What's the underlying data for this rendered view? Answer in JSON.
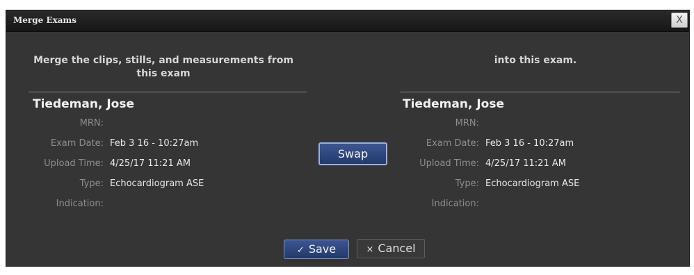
{
  "dialog": {
    "title": "Merge Exams",
    "close_glyph": "X"
  },
  "left": {
    "heading": "Merge the clips, stills, and measurements from this exam",
    "patient": "Tiedeman, Jose",
    "fields": [
      {
        "label": "MRN:",
        "value": ""
      },
      {
        "label": "Exam Date:",
        "value": "Feb 3 16 - 10:27am"
      },
      {
        "label": "Upload Time:",
        "value": "4/25/17 11:21 AM"
      },
      {
        "label": "Type:",
        "value": "Echocardiogram ASE"
      },
      {
        "label": "Indication:",
        "value": ""
      }
    ]
  },
  "right": {
    "heading": "into this exam.",
    "patient": "Tiedeman, Jose",
    "fields": [
      {
        "label": "MRN:",
        "value": ""
      },
      {
        "label": "Exam Date:",
        "value": "Feb 3 16 - 10:27am"
      },
      {
        "label": "Upload Time:",
        "value": "4/25/17 11:21 AM"
      },
      {
        "label": "Type:",
        "value": "Echocardiogram ASE"
      },
      {
        "label": "Indication:",
        "value": ""
      }
    ]
  },
  "buttons": {
    "swap": "Swap",
    "save_icon": "check-icon",
    "save_glyph": "✓",
    "save": "Save",
    "cancel_icon": "x-icon",
    "cancel_glyph": "×",
    "cancel": "Cancel"
  }
}
